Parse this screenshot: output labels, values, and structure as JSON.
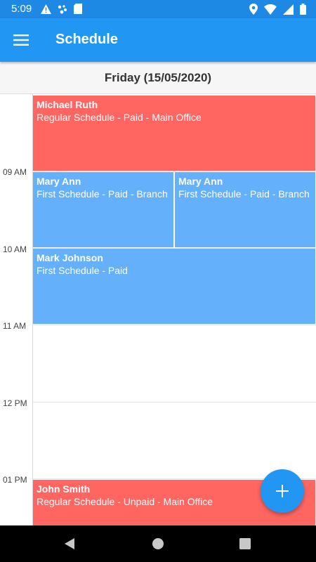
{
  "status_bar": {
    "time": "5:09",
    "left_icons": [
      "warning-icon",
      "assistant-dots-icon",
      "sd-card-icon"
    ],
    "right_icons": [
      "location-icon",
      "wifi-icon",
      "signal-icon",
      "battery-icon"
    ]
  },
  "app_bar": {
    "menu_icon": "hamburger-menu-icon",
    "title": "Schedule"
  },
  "date_header": {
    "label": "Friday (15/05/2020)"
  },
  "hours": [
    {
      "label": "09 AM"
    },
    {
      "label": "10 AM"
    },
    {
      "label": "11 AM"
    },
    {
      "label": "12 PM"
    },
    {
      "label": "01 PM"
    }
  ],
  "events": [
    {
      "name": "Michael Ruth",
      "detail": "Regular Schedule - Paid - Main Office",
      "color": "#ff6661"
    },
    {
      "name": "Mary Ann",
      "detail": "First Schedule - Paid - Branch",
      "color": "#64b0fb"
    },
    {
      "name": "Mary Ann",
      "detail": "First Schedule - Paid - Branch",
      "color": "#64b0fb"
    },
    {
      "name": "Mark Johnson",
      "detail": "First Schedule - Paid",
      "color": "#64b0fb"
    },
    {
      "name": "John Smith",
      "detail": "Regular Schedule - Unpaid - Main Office",
      "color": "#ff6661"
    }
  ],
  "fab": {
    "icon": "plus-icon",
    "color": "#2196f3"
  },
  "nav_bar": {
    "icons": [
      "back-icon",
      "home-icon",
      "recents-icon"
    ]
  },
  "colors": {
    "primary": "#2196f3",
    "status_bar": "#1e88e5",
    "event_red": "#ff6661",
    "event_blue": "#64b0fb"
  }
}
